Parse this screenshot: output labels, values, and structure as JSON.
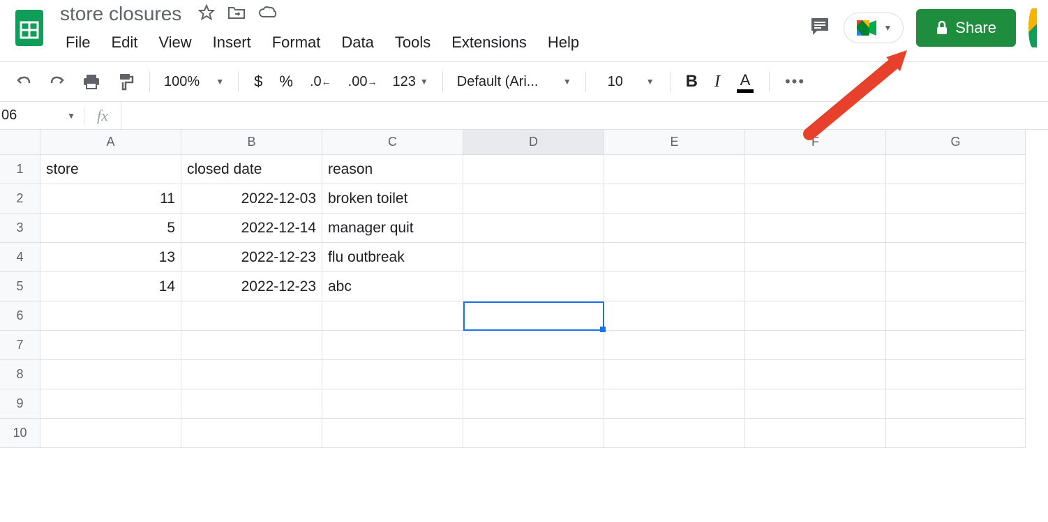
{
  "doc_title": "store closures",
  "menus": [
    "File",
    "Edit",
    "View",
    "Insert",
    "Format",
    "Data",
    "Tools",
    "Extensions",
    "Help"
  ],
  "share_label": "Share",
  "toolbar": {
    "zoom": "100%",
    "font": "Default (Ari...",
    "font_size": "10",
    "format_123": "123",
    "bold": "B",
    "italic": "I",
    "text_color": "A"
  },
  "name_box": "06",
  "fx": "fx",
  "columns": [
    "A",
    "B",
    "C",
    "D",
    "E",
    "F",
    "G"
  ],
  "rows": [
    "1",
    "2",
    "3",
    "4",
    "5",
    "6",
    "7",
    "8",
    "9",
    "10"
  ],
  "selected_col_index": 3,
  "selected_cell": {
    "row": 5,
    "col": 3
  },
  "sheet_data": [
    {
      "A": "store",
      "B": "closed date",
      "C": "reason"
    },
    {
      "A": "11",
      "B": "2022-12-03",
      "C": "broken toilet"
    },
    {
      "A": "5",
      "B": "2022-12-14",
      "C": "manager quit"
    },
    {
      "A": "13",
      "B": "2022-12-23",
      "C": "flu outbreak"
    },
    {
      "A": "14",
      "B": "2022-12-23",
      "C": "abc"
    }
  ]
}
